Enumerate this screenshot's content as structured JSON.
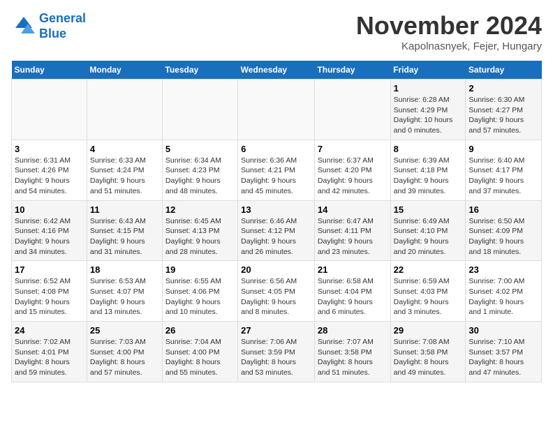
{
  "logo": {
    "line1": "General",
    "line2": "Blue"
  },
  "title": "November 2024",
  "location": "Kapolnasnyek, Fejer, Hungary",
  "days_of_week": [
    "Sunday",
    "Monday",
    "Tuesday",
    "Wednesday",
    "Thursday",
    "Friday",
    "Saturday"
  ],
  "weeks": [
    [
      {
        "day": "",
        "info": ""
      },
      {
        "day": "",
        "info": ""
      },
      {
        "day": "",
        "info": ""
      },
      {
        "day": "",
        "info": ""
      },
      {
        "day": "",
        "info": ""
      },
      {
        "day": "1",
        "info": "Sunrise: 6:28 AM\nSunset: 4:29 PM\nDaylight: 10 hours\nand 0 minutes."
      },
      {
        "day": "2",
        "info": "Sunrise: 6:30 AM\nSunset: 4:27 PM\nDaylight: 9 hours\nand 57 minutes."
      }
    ],
    [
      {
        "day": "3",
        "info": "Sunrise: 6:31 AM\nSunset: 4:26 PM\nDaylight: 9 hours\nand 54 minutes."
      },
      {
        "day": "4",
        "info": "Sunrise: 6:33 AM\nSunset: 4:24 PM\nDaylight: 9 hours\nand 51 minutes."
      },
      {
        "day": "5",
        "info": "Sunrise: 6:34 AM\nSunset: 4:23 PM\nDaylight: 9 hours\nand 48 minutes."
      },
      {
        "day": "6",
        "info": "Sunrise: 6:36 AM\nSunset: 4:21 PM\nDaylight: 9 hours\nand 45 minutes."
      },
      {
        "day": "7",
        "info": "Sunrise: 6:37 AM\nSunset: 4:20 PM\nDaylight: 9 hours\nand 42 minutes."
      },
      {
        "day": "8",
        "info": "Sunrise: 6:39 AM\nSunset: 4:18 PM\nDaylight: 9 hours\nand 39 minutes."
      },
      {
        "day": "9",
        "info": "Sunrise: 6:40 AM\nSunset: 4:17 PM\nDaylight: 9 hours\nand 37 minutes."
      }
    ],
    [
      {
        "day": "10",
        "info": "Sunrise: 6:42 AM\nSunset: 4:16 PM\nDaylight: 9 hours\nand 34 minutes."
      },
      {
        "day": "11",
        "info": "Sunrise: 6:43 AM\nSunset: 4:15 PM\nDaylight: 9 hours\nand 31 minutes."
      },
      {
        "day": "12",
        "info": "Sunrise: 6:45 AM\nSunset: 4:13 PM\nDaylight: 9 hours\nand 28 minutes."
      },
      {
        "day": "13",
        "info": "Sunrise: 6:46 AM\nSunset: 4:12 PM\nDaylight: 9 hours\nand 26 minutes."
      },
      {
        "day": "14",
        "info": "Sunrise: 6:47 AM\nSunset: 4:11 PM\nDaylight: 9 hours\nand 23 minutes."
      },
      {
        "day": "15",
        "info": "Sunrise: 6:49 AM\nSunset: 4:10 PM\nDaylight: 9 hours\nand 20 minutes."
      },
      {
        "day": "16",
        "info": "Sunrise: 6:50 AM\nSunset: 4:09 PM\nDaylight: 9 hours\nand 18 minutes."
      }
    ],
    [
      {
        "day": "17",
        "info": "Sunrise: 6:52 AM\nSunset: 4:08 PM\nDaylight: 9 hours\nand 15 minutes."
      },
      {
        "day": "18",
        "info": "Sunrise: 6:53 AM\nSunset: 4:07 PM\nDaylight: 9 hours\nand 13 minutes."
      },
      {
        "day": "19",
        "info": "Sunrise: 6:55 AM\nSunset: 4:06 PM\nDaylight: 9 hours\nand 10 minutes."
      },
      {
        "day": "20",
        "info": "Sunrise: 6:56 AM\nSunset: 4:05 PM\nDaylight: 9 hours\nand 8 minutes."
      },
      {
        "day": "21",
        "info": "Sunrise: 6:58 AM\nSunset: 4:04 PM\nDaylight: 9 hours\nand 6 minutes."
      },
      {
        "day": "22",
        "info": "Sunrise: 6:59 AM\nSunset: 4:03 PM\nDaylight: 9 hours\nand 3 minutes."
      },
      {
        "day": "23",
        "info": "Sunrise: 7:00 AM\nSunset: 4:02 PM\nDaylight: 9 hours\nand 1 minute."
      }
    ],
    [
      {
        "day": "24",
        "info": "Sunrise: 7:02 AM\nSunset: 4:01 PM\nDaylight: 8 hours\nand 59 minutes."
      },
      {
        "day": "25",
        "info": "Sunrise: 7:03 AM\nSunset: 4:00 PM\nDaylight: 8 hours\nand 57 minutes."
      },
      {
        "day": "26",
        "info": "Sunrise: 7:04 AM\nSunset: 4:00 PM\nDaylight: 8 hours\nand 55 minutes."
      },
      {
        "day": "27",
        "info": "Sunrise: 7:06 AM\nSunset: 3:59 PM\nDaylight: 8 hours\nand 53 minutes."
      },
      {
        "day": "28",
        "info": "Sunrise: 7:07 AM\nSunset: 3:58 PM\nDaylight: 8 hours\nand 51 minutes."
      },
      {
        "day": "29",
        "info": "Sunrise: 7:08 AM\nSunset: 3:58 PM\nDaylight: 8 hours\nand 49 minutes."
      },
      {
        "day": "30",
        "info": "Sunrise: 7:10 AM\nSunset: 3:57 PM\nDaylight: 8 hours\nand 47 minutes."
      }
    ]
  ]
}
